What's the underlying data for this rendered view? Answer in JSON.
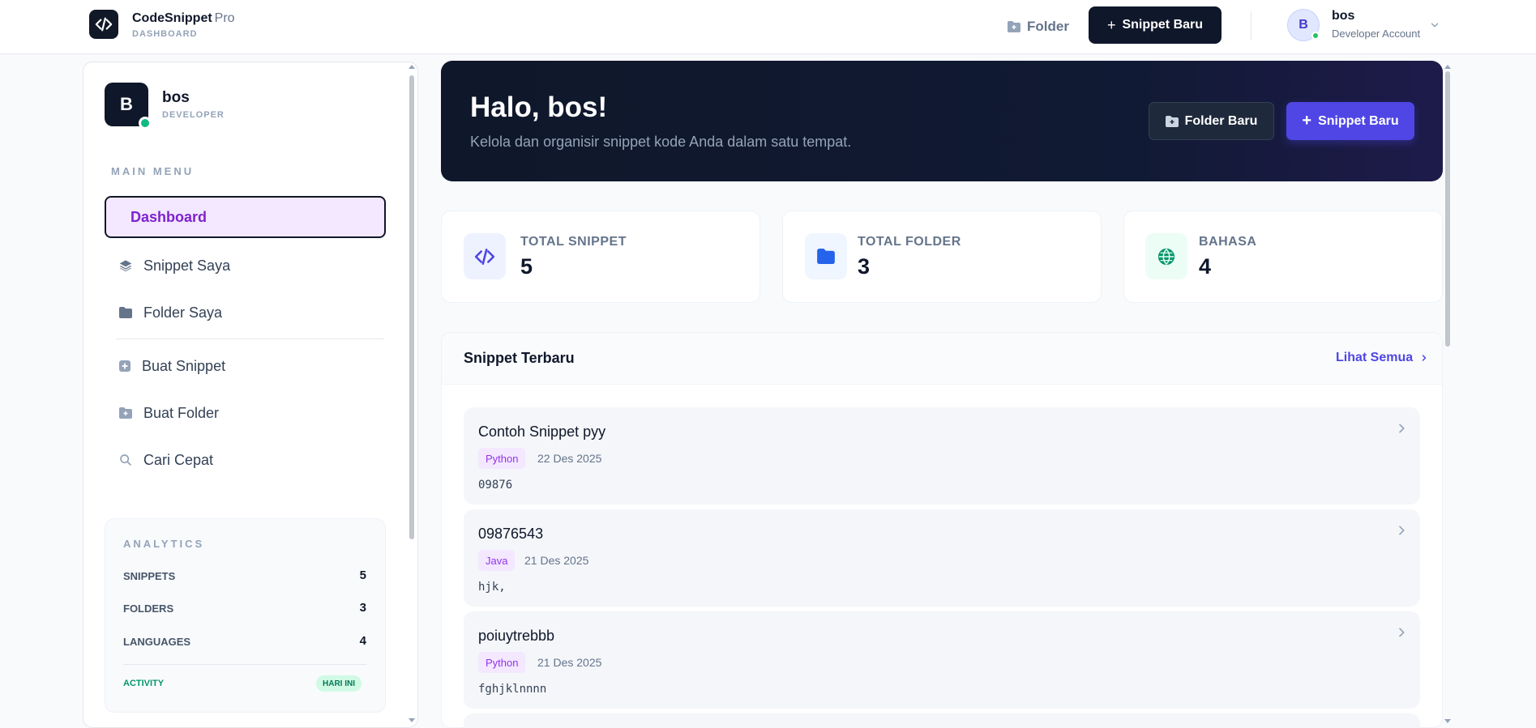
{
  "header": {
    "brand_name": "CodeSnippet",
    "brand_suffix": "Pro",
    "brand_sub": "DASHBOARD",
    "folder_label": "Folder",
    "new_snippet_label": "Snippet Baru",
    "avatar_initial": "B",
    "user_name": "bos",
    "user_role": "Developer Account"
  },
  "sidebar": {
    "avatar_initial": "B",
    "user_name": "bos",
    "user_role": "DEVELOPER",
    "menu_title": "MAIN MENU",
    "items": [
      {
        "label": "Dashboard",
        "icon": "dashboard",
        "active": true
      },
      {
        "label": "Snippet Saya",
        "icon": "layers-icon"
      },
      {
        "label": "Folder Saya",
        "icon": "folder-icon"
      },
      {
        "label": "Buat Snippet",
        "icon": "plus-square-icon"
      },
      {
        "label": "Buat Folder",
        "icon": "folder-plus-icon"
      },
      {
        "label": "Cari Cepat",
        "icon": "search-icon"
      }
    ],
    "analytics": {
      "title": "ANALYTICS",
      "rows": [
        {
          "label": "SNIPPETS",
          "value": "5"
        },
        {
          "label": "FOLDERS",
          "value": "3"
        },
        {
          "label": "LANGUAGES",
          "value": "4"
        }
      ],
      "activity_label": "ACTIVITY",
      "activity_badge": "HARI INI"
    }
  },
  "hero": {
    "title": "Halo, bos!",
    "subtitle": "Kelola dan organisir snippet kode Anda dalam satu tempat.",
    "folder_button": "Folder Baru",
    "snippet_button": "Snippet Baru"
  },
  "stats": [
    {
      "label": "TOTAL SNIPPET",
      "value": "5",
      "icon": "code-icon",
      "color": "#4f46e5"
    },
    {
      "label": "TOTAL FOLDER",
      "value": "3",
      "icon": "folder-icon",
      "color": "#2563eb"
    },
    {
      "label": "BAHASA",
      "value": "4",
      "icon": "globe-icon",
      "color": "#059669"
    }
  ],
  "recent": {
    "title": "Snippet Terbaru",
    "see_all": "Lihat Semua",
    "items": [
      {
        "title": "Contoh Snippet pyy",
        "language": "Python",
        "date": "22 Des 2025",
        "code": "09876"
      },
      {
        "title": "09876543",
        "language": "Java",
        "date": "21 Des 2025",
        "code": "hjk,"
      },
      {
        "title": "poiuytrebbb",
        "language": "Python",
        "date": "21 Des 2025",
        "code": "fghjklnnnn"
      }
    ]
  },
  "colors": {
    "accent": "#4f46e5",
    "dark": "#0f172a",
    "active_menu_bg": "#f3e8ff",
    "active_menu_text": "#7e22ce",
    "online": "#10b981"
  }
}
